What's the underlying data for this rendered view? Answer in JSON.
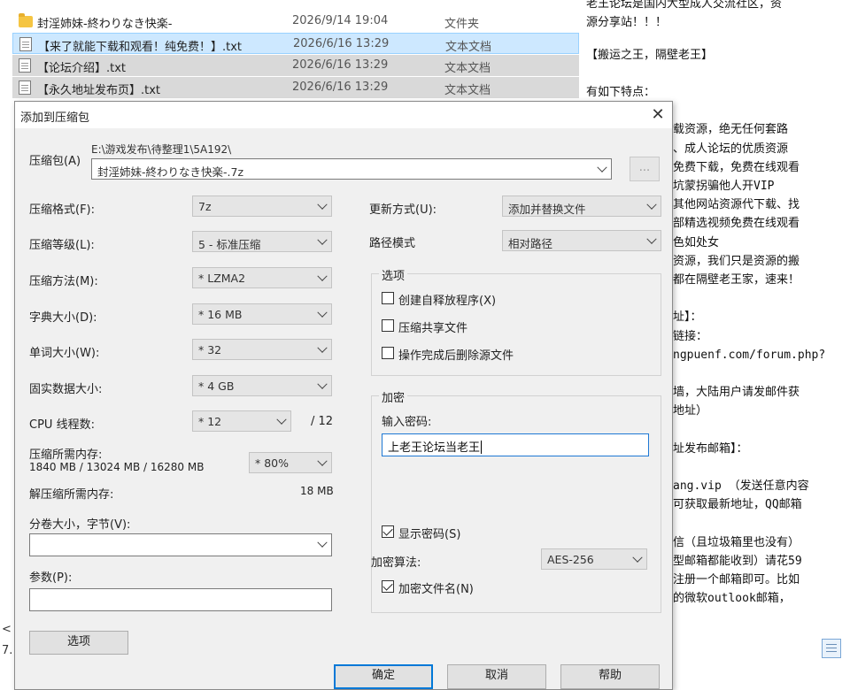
{
  "explorer": {
    "files": [
      {
        "name": "封淫姉妹-終わりなき快楽-",
        "date": "2026/9/14 19:04",
        "type": "文件夹",
        "icon": "folder-icon"
      },
      {
        "name": "【来了就能下载和观看！纯免费！】.txt",
        "date": "2026/6/16 13:29",
        "type": "文本文档",
        "icon": "text-file-icon"
      },
      {
        "name": "【论坛介绍】.txt",
        "date": "2026/6/16 13:29",
        "type": "文本文档",
        "icon": "text-file-icon"
      },
      {
        "name": "【永久地址发布页】.txt",
        "date": "2026/6/16 13:29",
        "type": "文本文档",
        "icon": "text-file-icon"
      }
    ],
    "left_sliver": [
      "<",
      "7."
    ]
  },
  "document": {
    "lines": [
      "老王论坛是国内大型成人交流社区，资",
      "源分享站！！！",
      "",
      "【搬运之王，隔壁老王】",
      "",
      "有如下特点：",
      "",
      "载资源，绝无任何套路",
      "、成人论坛的优质资源",
      "免费下载，免费在线观看",
      "坑蒙拐骗他人开VIP",
      "其他网站资源代下载、找",
      "部精选视频免费在线观看",
      "色如处女",
      "资源，我们只是资源的搬",
      "都在隔壁老王家，速来！",
      "",
      "址】：",
      "链接：",
      "ngpuenf.com/forum.php?",
      "",
      "墙，大陆用户请发邮件获",
      "地址）",
      "",
      "址发布邮箱】：",
      "",
      "ang.vip  （发送任意内容",
      "可获取最新地址，QQ邮箱",
      "",
      "信（且垃圾箱里也没有）",
      "型邮箱都能收到）请花59",
      "注册一个邮箱即可。比如",
      "的微软outlook邮箱，"
    ]
  },
  "dialog": {
    "title": "添加到压缩包",
    "close_label": "✕",
    "archive_label": "压缩包(A)",
    "archive_path": "E:\\游戏发布\\待整理1\\5A192\\",
    "archive_name": "封淫姉妹-終わりなき快楽-.7z",
    "browse_label": "...",
    "format_label": "压缩格式(F):",
    "format_value": "7z",
    "level_label": "压缩等级(L):",
    "level_value": "5 - 标准压缩",
    "method_label": "压缩方法(M):",
    "method_value": "* LZMA2",
    "dict_label": "字典大小(D):",
    "dict_value": "* 16 MB",
    "word_label": "单词大小(W):",
    "word_value": "* 32",
    "solid_label": "固实数据大小:",
    "solid_value": "* 4 GB",
    "cpu_label": "CPU 线程数:",
    "cpu_value": "* 12",
    "cpu_max": "/ 12",
    "mem_label": "压缩所需内存:",
    "mem_values": "1840 MB / 13024 MB / 16280 MB",
    "mem_percent": "* 80%",
    "decomp_label": "解压缩所需内存:",
    "decomp_value": "18 MB",
    "volume_label": "分卷大小，字节(V):",
    "volume_value": "",
    "params_label": "参数(P):",
    "params_value": "",
    "options_button": "选项",
    "update_label": "更新方式(U):",
    "update_value": "添加并替换文件",
    "path_label": "路径模式",
    "path_value": "相对路径",
    "options_group": "选项",
    "opt_sfx": "创建自释放程序(X)",
    "opt_shared": "压缩共享文件",
    "opt_delete": "操作完成后删除源文件",
    "encrypt_group": "加密",
    "password_label": "输入密码:",
    "password_value": "上老王论坛当老王",
    "show_password": "显示密码(S)",
    "algo_label": "加密算法:",
    "algo_value": "AES-256",
    "encrypt_names": "加密文件名(N)",
    "ok_button": "确定",
    "cancel_button": "取消",
    "help_button": "帮助"
  }
}
